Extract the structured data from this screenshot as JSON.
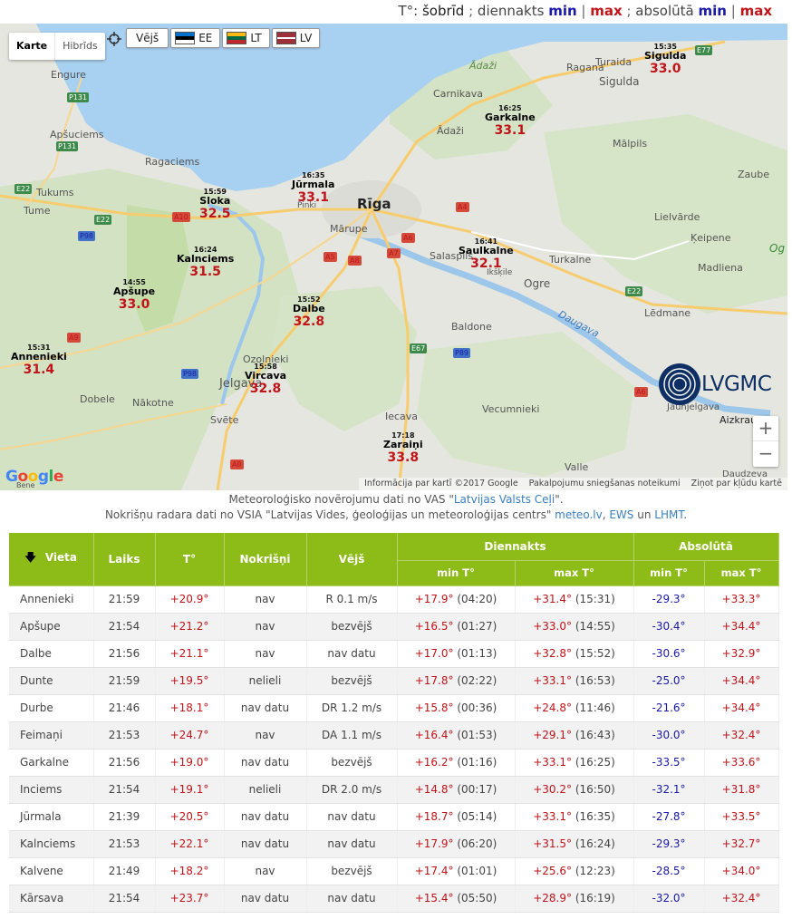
{
  "legend": {
    "prefix": "T°: ",
    "now": "šobrīd",
    "sep1": " ; ",
    "daily": "diennakts ",
    "min1": "min",
    "bar1": " | ",
    "max1": "max",
    "sep2": " ; ",
    "absolute": "absolūtā ",
    "min2": "min",
    "bar2": " | ",
    "max2": "max"
  },
  "map": {
    "type_buttons": [
      "Karte",
      "Hibrīds"
    ],
    "layers": {
      "wind": "Vējš",
      "ee": "EE",
      "lt": "LT",
      "lv": "LV"
    },
    "zoom_in": "+",
    "zoom_out": "−",
    "google": [
      "G",
      "o",
      "o",
      "g",
      "l",
      "e"
    ],
    "attribution": [
      "Informācija par kartī ©2017 Google",
      "Pakalpojumu sniegšanas noteikumi",
      "Ziņot par kļūdu kartē"
    ],
    "brand": "LVGMC",
    "places": [
      {
        "label": "Engure"
      },
      {
        "label": "Apšuciems"
      },
      {
        "label": "Ragaciems"
      },
      {
        "label": "Tukums"
      },
      {
        "label": "Tume"
      },
      {
        "label": "Rīga"
      },
      {
        "label": "Mārupe"
      },
      {
        "label": "Salaspils"
      },
      {
        "label": "Ādaži"
      },
      {
        "label": "Carnikava"
      },
      {
        "label": "Ādaži"
      },
      {
        "label": "Ragana"
      },
      {
        "label": "Turaida"
      },
      {
        "label": "Sigulda"
      },
      {
        "label": "Mālpils"
      },
      {
        "label": "Zaube"
      },
      {
        "label": "Lielvārde"
      },
      {
        "label": "Ķeipene"
      },
      {
        "label": "Madliena"
      },
      {
        "label": "Turkalne"
      },
      {
        "label": "Ogre"
      },
      {
        "label": "Lēdmane"
      },
      {
        "label": "Baldone"
      },
      {
        "label": "Ozolnieki"
      },
      {
        "label": "Jelgava"
      },
      {
        "label": "Dobele"
      },
      {
        "label": "Nākotne"
      },
      {
        "label": "Svēte"
      },
      {
        "label": "Iecava"
      },
      {
        "label": "Vecumnieki"
      },
      {
        "label": "Valle"
      },
      {
        "label": "Aizkraukle"
      },
      {
        "label": "Daudzeva"
      },
      {
        "label": "Daugava"
      },
      {
        "label": "Pinki"
      },
      {
        "label": "Ikšķile"
      },
      {
        "label": "Jaunjelgava"
      },
      {
        "label": "Bene"
      },
      {
        "label": "Og"
      }
    ],
    "roads": [
      "P131",
      "P131",
      "E22",
      "A10",
      "E22",
      "P98",
      "A9",
      "P98",
      "A5",
      "A8",
      "A7",
      "A6",
      "A4",
      "E67",
      "P89",
      "E22",
      "A6",
      "A8",
      "E77"
    ],
    "stations": [
      {
        "time": "15:35",
        "name": "Sigulda",
        "value": "33.0"
      },
      {
        "time": "16:25",
        "name": "Garkalne",
        "value": "33.1"
      },
      {
        "time": "16:35",
        "name": "Jūrmala",
        "value": "33.1"
      },
      {
        "time": "15:59",
        "name": "Sloka",
        "value": "32.5"
      },
      {
        "time": "16:41",
        "name": "Saulkalne",
        "value": "32.1"
      },
      {
        "time": "16:24",
        "name": "Kalnciems",
        "value": "31.5"
      },
      {
        "time": "14:55",
        "name": "Apšupe",
        "value": "33.0"
      },
      {
        "time": "15:52",
        "name": "Dalbe",
        "value": "32.8"
      },
      {
        "time": "15:31",
        "name": "Annenieki",
        "value": "31.4"
      },
      {
        "time": "15:58",
        "name": "Vircava",
        "value": "32.8"
      },
      {
        "time": "17:18",
        "name": "Zaraiņi",
        "value": "33.8"
      }
    ]
  },
  "info": {
    "line1_pre": "Meteoroloģisko novērojumu dati no VAS \"",
    "line1_link": "Latvijas Valsts Ceļi",
    "line1_post": "\".",
    "line2_pre": "Nokrišņu radara dati no VSIA \"Latvijas Vides, ģeoloģijas un meteoroloģijas centrs\" ",
    "line2_link1": "meteo.lv",
    "line2_mid": ", ",
    "line2_link2": "EWS",
    "line2_and": " un ",
    "line2_link3": "LHMT",
    "line2_post": "."
  },
  "table": {
    "sort_icon": "🡇",
    "headers": {
      "vieta": "Vieta",
      "laiks": "Laiks",
      "temp": "T°",
      "precip": "Nokrišņi",
      "wind": "Vējš",
      "daily": "Diennakts",
      "absolute": "Absolūtā",
      "daily_min": "min T°",
      "daily_max": "max T°",
      "abs_min": "min T°",
      "abs_max": "max T°"
    },
    "rows": [
      {
        "name": "Annenieki",
        "time": "21:59",
        "temp": "+20.9°",
        "precip": "nav",
        "wind": "R 0.1 m/s",
        "dmin": "+17.9°",
        "dmin_t": "(04:20)",
        "dmax": "+31.4°",
        "dmax_t": "(15:31)",
        "amin": "-29.3°",
        "amax": "+33.3°"
      },
      {
        "name": "Apšupe",
        "time": "21:54",
        "temp": "+21.2°",
        "precip": "nav",
        "wind": "bezvējš",
        "dmin": "+16.5°",
        "dmin_t": "(01:27)",
        "dmax": "+33.0°",
        "dmax_t": "(14:55)",
        "amin": "-30.4°",
        "amax": "+34.4°"
      },
      {
        "name": "Dalbe",
        "time": "21:56",
        "temp": "+21.1°",
        "precip": "nav",
        "wind": "nav datu",
        "dmin": "+17.0°",
        "dmin_t": "(01:13)",
        "dmax": "+32.8°",
        "dmax_t": "(15:52)",
        "amin": "-30.6°",
        "amax": "+32.9°"
      },
      {
        "name": "Dunte",
        "time": "21:59",
        "temp": "+19.5°",
        "precip": "nelieli",
        "wind": "bezvējš",
        "dmin": "+17.8°",
        "dmin_t": "(02:22)",
        "dmax": "+33.1°",
        "dmax_t": "(16:53)",
        "amin": "-25.0°",
        "amax": "+34.4°"
      },
      {
        "name": "Durbe",
        "time": "21:46",
        "temp": "+18.1°",
        "precip": "nav datu",
        "wind": "DR 1.2 m/s",
        "dmin": "+15.8°",
        "dmin_t": "(00:36)",
        "dmax": "+24.8°",
        "dmax_t": "(11:46)",
        "amin": "-21.6°",
        "amax": "+34.4°"
      },
      {
        "name": "Feimaņi",
        "time": "21:53",
        "temp": "+24.7°",
        "precip": "nav",
        "wind": "DA 1.1 m/s",
        "dmin": "+16.4°",
        "dmin_t": "(01:53)",
        "dmax": "+29.1°",
        "dmax_t": "(16:43)",
        "amin": "-30.0°",
        "amax": "+32.4°"
      },
      {
        "name": "Garkalne",
        "time": "21:56",
        "temp": "+19.0°",
        "precip": "nav datu",
        "wind": "bezvējš",
        "dmin": "+16.2°",
        "dmin_t": "(01:16)",
        "dmax": "+33.1°",
        "dmax_t": "(16:25)",
        "amin": "-33.5°",
        "amax": "+33.6°"
      },
      {
        "name": "Inciems",
        "time": "21:54",
        "temp": "+19.1°",
        "precip": "nelieli",
        "wind": "DR 2.0 m/s",
        "dmin": "+14.8°",
        "dmin_t": "(00:17)",
        "dmax": "+30.2°",
        "dmax_t": "(16:50)",
        "amin": "-32.1°",
        "amax": "+31.8°"
      },
      {
        "name": "Jūrmala",
        "time": "21:39",
        "temp": "+20.5°",
        "precip": "nav datu",
        "wind": "nav datu",
        "dmin": "+18.7°",
        "dmin_t": "(05:14)",
        "dmax": "+33.1°",
        "dmax_t": "(16:35)",
        "amin": "-27.8°",
        "amax": "+33.5°"
      },
      {
        "name": "Kalnciems",
        "time": "21:53",
        "temp": "+22.1°",
        "precip": "nav datu",
        "wind": "nav datu",
        "dmin": "+17.9°",
        "dmin_t": "(06:20)",
        "dmax": "+31.5°",
        "dmax_t": "(16:24)",
        "amin": "-29.3°",
        "amax": "+32.7°"
      },
      {
        "name": "Kalvene",
        "time": "21:49",
        "temp": "+18.2°",
        "precip": "nav",
        "wind": "bezvējš",
        "dmin": "+17.4°",
        "dmin_t": "(01:01)",
        "dmax": "+25.6°",
        "dmax_t": "(12:23)",
        "amin": "-28.5°",
        "amax": "+34.0°"
      },
      {
        "name": "Kārsava",
        "time": "21:54",
        "temp": "+23.7°",
        "precip": "nav datu",
        "wind": "nav datu",
        "dmin": "+15.4°",
        "dmin_t": "(05:50)",
        "dmax": "+28.9°",
        "dmax_t": "(16:19)",
        "amin": "-32.0°",
        "amax": "+32.4°"
      }
    ]
  },
  "colors": {
    "header_green": "#8dbb18",
    "max_red": "#c0141a",
    "min_blue": "#1a1aa6",
    "link_blue": "#3a7fc1"
  }
}
